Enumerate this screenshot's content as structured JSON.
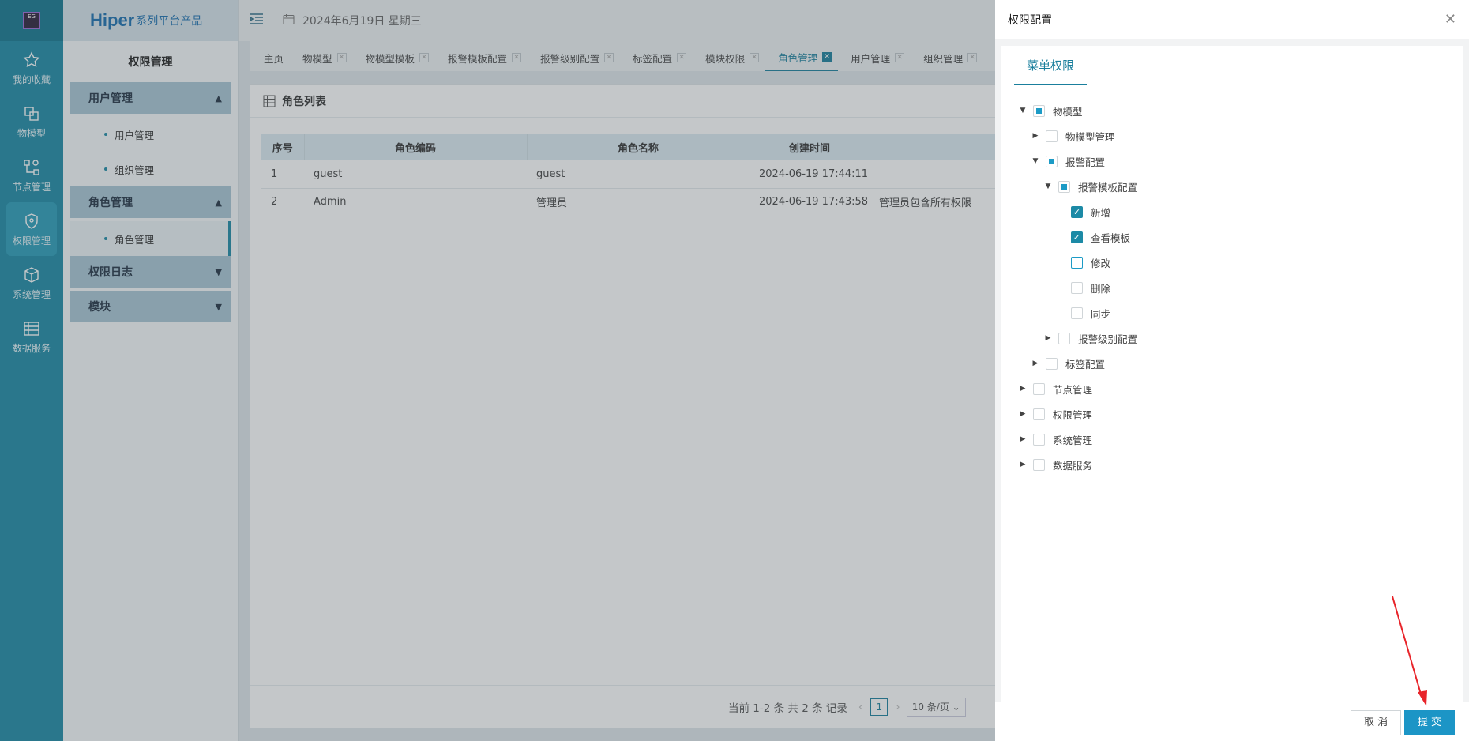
{
  "brand": {
    "name": "Hiper",
    "suffix": "系列平台产品",
    "logo_text": "EG"
  },
  "rail": [
    {
      "label": "我的收藏",
      "icon": "star-icon",
      "active": false
    },
    {
      "label": "物模型",
      "icon": "model-icon",
      "active": false
    },
    {
      "label": "节点管理",
      "icon": "node-icon",
      "active": false
    },
    {
      "label": "权限管理",
      "icon": "shield-icon",
      "active": true
    },
    {
      "label": "系统管理",
      "icon": "cube-icon",
      "active": false
    },
    {
      "label": "数据服务",
      "icon": "data-icon",
      "active": false
    }
  ],
  "menu": {
    "title": "权限管理",
    "groups": [
      {
        "label": "用户管理",
        "expanded": true,
        "items": [
          "用户管理",
          "组织管理"
        ]
      },
      {
        "label": "角色管理",
        "expanded": true,
        "items": [
          "角色管理"
        ]
      },
      {
        "label": "权限日志",
        "expanded": false,
        "items": []
      },
      {
        "label": "模块",
        "expanded": false,
        "items": []
      }
    ]
  },
  "topbar": {
    "date": "2024年6月19日 星期三"
  },
  "tabs": [
    {
      "label": "主页",
      "closable": false
    },
    {
      "label": "物模型",
      "closable": true
    },
    {
      "label": "物模型模板",
      "closable": true
    },
    {
      "label": "报警模板配置",
      "closable": true
    },
    {
      "label": "报警级别配置",
      "closable": true
    },
    {
      "label": "标签配置",
      "closable": true
    },
    {
      "label": "模块权限",
      "closable": true
    },
    {
      "label": "角色管理",
      "closable": true,
      "active": true
    },
    {
      "label": "用户管理",
      "closable": true
    },
    {
      "label": "组织管理",
      "closable": true
    }
  ],
  "content": {
    "title": "角色列表",
    "columns": [
      "序号",
      "角色编码",
      "角色名称",
      "创建时间"
    ],
    "rows": [
      [
        "1",
        "guest",
        "guest",
        "2024-06-19 17:44:11",
        ""
      ],
      [
        "2",
        "Admin",
        "管理员",
        "2024-06-19 17:43:58",
        "管理员包含所有权限"
      ]
    ],
    "pager": {
      "summary": "当前 1-2 条 共 2 条 记录",
      "page": "1",
      "page_size": "10 条/页"
    }
  },
  "drawer": {
    "title": "权限配置",
    "tab": "菜单权限",
    "tree": [
      {
        "label": "物模型",
        "level": 0,
        "arrow": "down",
        "state": "half"
      },
      {
        "label": "物模型管理",
        "level": 1,
        "arrow": "right",
        "state": "none"
      },
      {
        "label": "报警配置",
        "level": 1,
        "arrow": "down",
        "state": "half"
      },
      {
        "label": "报警模板配置",
        "level": 2,
        "arrow": "down",
        "state": "half"
      },
      {
        "label": "新增",
        "level": 3,
        "arrow": "",
        "state": "checked"
      },
      {
        "label": "查看模板",
        "level": 3,
        "arrow": "",
        "state": "checked"
      },
      {
        "label": "修改",
        "level": 3,
        "arrow": "",
        "state": "focus"
      },
      {
        "label": "删除",
        "level": 3,
        "arrow": "",
        "state": "none"
      },
      {
        "label": "同步",
        "level": 3,
        "arrow": "",
        "state": "none"
      },
      {
        "label": "报警级别配置",
        "level": 2,
        "arrow": "right",
        "state": "none"
      },
      {
        "label": "标签配置",
        "level": 1,
        "arrow": "right",
        "state": "none"
      },
      {
        "label": "节点管理",
        "level": 0,
        "arrow": "right",
        "state": "none"
      },
      {
        "label": "权限管理",
        "level": 0,
        "arrow": "right",
        "state": "none"
      },
      {
        "label": "系统管理",
        "level": 0,
        "arrow": "right",
        "state": "none"
      },
      {
        "label": "数据服务",
        "level": 0,
        "arrow": "right",
        "state": "none"
      }
    ],
    "cancel": "取 消",
    "submit": "提 交"
  },
  "colors": {
    "accent": "#1c8aa6",
    "primary_button": "#1c95c6",
    "annotation_arrow": "#e8242a"
  }
}
